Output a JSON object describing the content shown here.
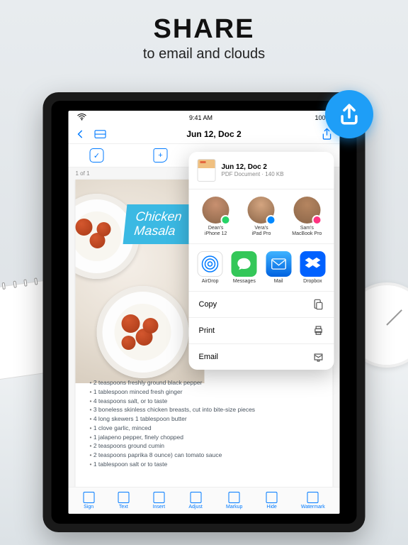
{
  "promo": {
    "title": "SHARE",
    "subtitle": "to email and clouds"
  },
  "status": {
    "time": "9:41 AM",
    "battery": "100%"
  },
  "nav": {
    "title": "Jun 12, Doc 2"
  },
  "doc": {
    "page_indicator": "1 of 1",
    "recipe_title_line1": "Chicken",
    "recipe_title_line2": "Masala",
    "ingredients": [
      "2 teaspoons freshly ground black pepper",
      "1 tablespoon minced fresh ginger",
      "4 teaspoons salt, or to taste",
      "3 boneless skinless chicken breasts, cut into bite-size pieces",
      "4 long skewers 1 tablespoon butter",
      "1 clove garlic, minced",
      "1 jalapeno pepper, finely chopped",
      "2 teaspoons ground cumin",
      "2 teaspoons paprika 8 ounce) can tomato sauce",
      "1 tablespoon salt or to taste"
    ]
  },
  "toolbar": {
    "items": [
      "Sign",
      "Text",
      "Insert",
      "Adjust",
      "Markup",
      "Hide",
      "Watermark"
    ]
  },
  "share": {
    "doc_title": "Jun 12, Doc 2",
    "doc_meta": "PDF Document · 140 KB",
    "contacts": [
      {
        "name": "Dean's",
        "device": "iPhone 12",
        "color": "#c89070",
        "badge": "#25d366"
      },
      {
        "name": "Vera's",
        "device": "iPad Pro",
        "color": "#d4a580",
        "badge": "#0088ff"
      },
      {
        "name": "Sam's",
        "device": "MacBook Pro",
        "color": "#b58560",
        "badge": "#ff3380"
      }
    ],
    "apps": [
      {
        "label": "AirDrop",
        "bg": "airdrop"
      },
      {
        "label": "Messages",
        "bg": "#34c759"
      },
      {
        "label": "Mail",
        "bg": "#1f8fff"
      },
      {
        "label": "Dropbox",
        "bg": "#0061ff"
      }
    ],
    "actions": [
      "Copy",
      "Print",
      "Email"
    ]
  }
}
